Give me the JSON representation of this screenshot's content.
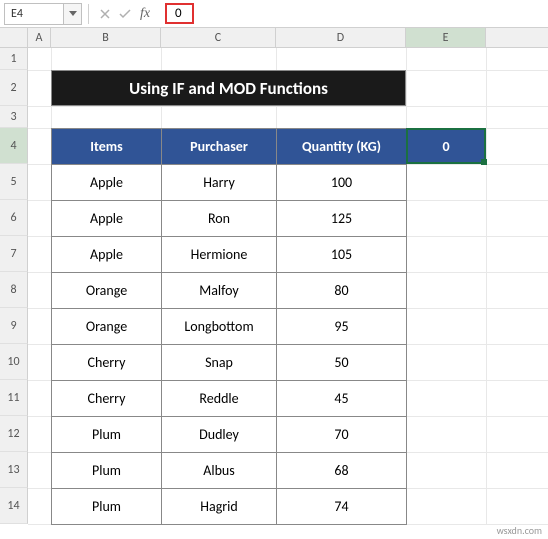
{
  "name_box": "E4",
  "formula_value": "0",
  "columns": [
    "A",
    "B",
    "C",
    "D",
    "E"
  ],
  "selected_column": "E",
  "row_numbers": [
    "1",
    "2",
    "3",
    "4",
    "5",
    "6",
    "7",
    "8",
    "9",
    "10",
    "11",
    "12",
    "13",
    "14"
  ],
  "selected_row": "4",
  "title": "Using  IF and MOD Functions",
  "headers": {
    "items": "Items",
    "purchaser": "Purchaser",
    "quantity": "Quantity (KG)"
  },
  "e4_value": "0",
  "rows": [
    {
      "item": "Apple",
      "purchaser": "Harry",
      "qty": "100"
    },
    {
      "item": "Apple",
      "purchaser": "Ron",
      "qty": "125"
    },
    {
      "item": "Apple",
      "purchaser": "Hermione",
      "qty": "105"
    },
    {
      "item": "Orange",
      "purchaser": "Malfoy",
      "qty": "80"
    },
    {
      "item": "Orange",
      "purchaser": "Longbottom",
      "qty": "95"
    },
    {
      "item": "Cherry",
      "purchaser": "Snap",
      "qty": "50"
    },
    {
      "item": "Cherry",
      "purchaser": "Reddle",
      "qty": "45"
    },
    {
      "item": "Plum",
      "purchaser": "Dudley",
      "qty": "70"
    },
    {
      "item": "Plum",
      "purchaser": "Albus",
      "qty": "68"
    },
    {
      "item": "Plum",
      "purchaser": "Hagrid",
      "qty": "74"
    }
  ],
  "watermark": "wsxdn.com"
}
